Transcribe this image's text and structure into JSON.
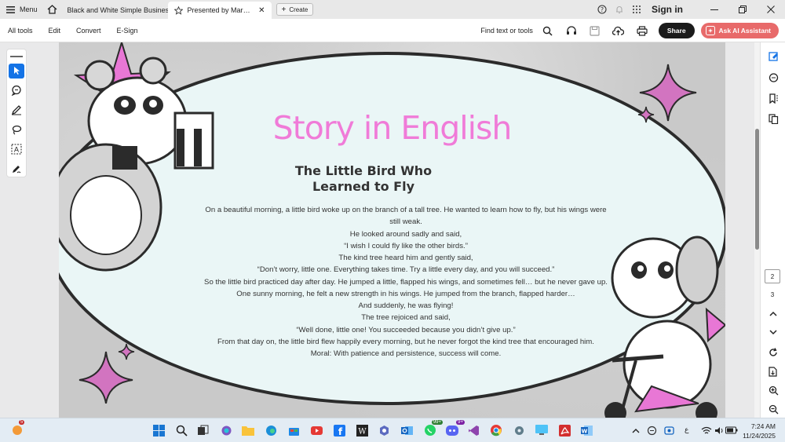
{
  "tabbar": {
    "menu_label": "Menu",
    "tabs": [
      {
        "label": "Black and White Simple Business..."
      },
      {
        "label": "Presented by Maraim Ha..."
      }
    ],
    "create_label": "Create",
    "signin_label": "Sign in"
  },
  "toolbar": {
    "menus": [
      "All tools",
      "Edit",
      "Convert",
      "E-Sign"
    ],
    "find_label": "Find text or tools",
    "share_label": "Share",
    "ai_label": "Ask AI Assistant"
  },
  "document": {
    "title": "Story in English",
    "subtitle_line1": "The Little Bird Who",
    "subtitle_line2": "Learned to Fly",
    "story_lines": [
      "On a beautiful morning, a little bird woke up on the branch of a tall tree. He wanted to learn how to fly, but his wings were still weak.",
      "He looked around sadly and said,",
      "“I wish I could fly like the other birds.”",
      "The kind tree heard him and gently said,",
      "“Don’t worry, little one. Everything takes time. Try a little every day, and you will succeed.”",
      "So the little bird practiced day after day. He jumped a little, flapped his wings, and sometimes fell… but he never gave up.",
      "One sunny morning, he felt a new strength in his wings. He jumped from the branch, flapped harder…",
      "And suddenly, he was flying!",
      "The tree rejoiced and said,",
      "“Well done, little one! You succeeded because you didn’t give up.”",
      "From that day on, the little bird flew happily every morning, but he never forgot the kind tree that encouraged him.",
      "Moral: With patience and persistence, success will come."
    ]
  },
  "pages": {
    "current": "2",
    "next": "3"
  },
  "taskbar": {
    "badges": {
      "weather": "5",
      "whatsapp": "99+",
      "discord": "9+"
    },
    "tray_lang": "ع",
    "time": "7:24 AM",
    "date": "11/24/2025"
  },
  "colors": {
    "title_pink": "#f07bd8",
    "ai_button": "#e86a6a",
    "select_blue": "#1473e6",
    "oval_fill": "#eaf6f6"
  }
}
